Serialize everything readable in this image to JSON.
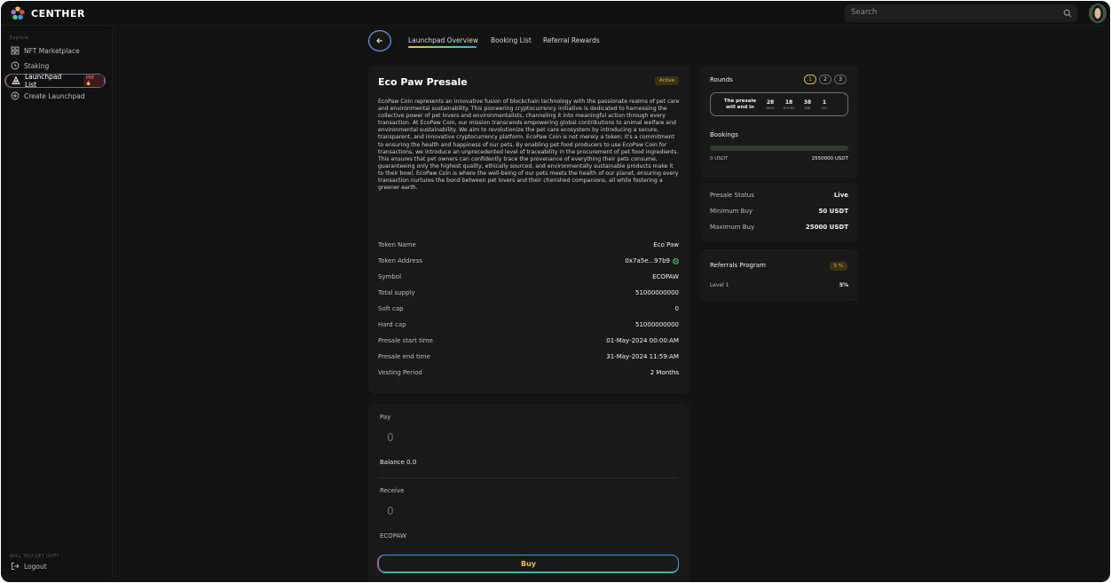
{
  "app": {
    "brand": "CENTHER"
  },
  "search": {
    "placeholder": "Search"
  },
  "sidebar": {
    "section_label": "Explore",
    "items": [
      {
        "label": "NFT Marketplace"
      },
      {
        "label": "Staking"
      },
      {
        "label": "Launchpad List",
        "badge": "PRE 🔥"
      },
      {
        "label": "Create Launchpad"
      }
    ],
    "footer_label": "WILL YOU GET OUT?",
    "logout": "Logout"
  },
  "tabs": [
    "Launchpad Overview",
    "Booking List",
    "Referral Rewards"
  ],
  "presale": {
    "title": "Eco Paw Presale",
    "status_badge": "Active",
    "description": "EcoPaw Coin represents an innovative fusion of blockchain technology with the passionate realms of pet care and environmental sustainability. This pioneering cryptocurrency initiative is dedicated to harnessing the collective power of pet lovers and environmentalists, channeling it into meaningful action through every transaction. At EcoPaw Coin, our mission transcends empowering global contributions to animal welfare and environmental sustainability. We aim to revolutionize the pet care ecosystem by introducing a secure, transparent, and innovative cryptocurrency platform. EcoPaw Coin is not merely a token; it's a commitment to ensuring the health and happiness of our pets. By enabling pet food producers to use EcoPaw Coin for transactions, we introduce an unprecedented level of traceability in the procurement of pet food ingredients. This ensures that pet owners can confidently trace the provenance of everything their pets consume, guaranteeing only the highest quality, ethically sourced, and environmentally sustainable products make it to their bowl. EcoPaw Coin is where the well-being of our pets meets the health of our planet, ensuring every transaction nurtures the bond between pet lovers and their cherished companions, all while fostering a greener earth.",
    "details": [
      {
        "label": "Token Name",
        "value": "Eco Paw"
      },
      {
        "label": "Token Address",
        "value": "0x7a5e...97b9"
      },
      {
        "label": "Symbol",
        "value": "ECOPAW"
      },
      {
        "label": "Total supply",
        "value": "51000000000"
      },
      {
        "label": "Soft cap",
        "value": "0"
      },
      {
        "label": "Hard cap",
        "value": "51000000000"
      },
      {
        "label": "Presale start time",
        "value": "01-May-2024 00:00:AM"
      },
      {
        "label": "Presale end time",
        "value": "31-May-2024 11:59:AM"
      },
      {
        "label": "Vesting Period",
        "value": "2 Months"
      }
    ]
  },
  "trade": {
    "pay_label": "Pay",
    "pay_value": "0",
    "balance": "Balance 0.0",
    "receive_label": "Receive",
    "receive_value": "0",
    "receive_token": "ECOPAW",
    "buy_label": "Buy"
  },
  "rounds": {
    "label": "Rounds",
    "pills": [
      "1",
      "2",
      "3"
    ],
    "active_round": "1",
    "countdown_label": "The presale will end in",
    "countdown": [
      {
        "value": "28",
        "unit": "DAYS"
      },
      {
        "value": "18",
        "unit": "HOURS"
      },
      {
        "value": "38",
        "unit": "MIN"
      },
      {
        "value": "1",
        "unit": "SEC"
      }
    ],
    "bookings_label": "Bookings",
    "bookings_min": "0 USDT",
    "bookings_max": "2550000 USDT",
    "bookings_progress": 0
  },
  "status": [
    {
      "label": "Presale Status",
      "value": "Live"
    },
    {
      "label": "Minimum Buy",
      "value": "50 USDT"
    },
    {
      "label": "Maximum Buy",
      "value": "25000 USDT"
    }
  ],
  "referrals": {
    "label": "Referrals Program",
    "badge": "5 %",
    "level_label": "Level 1",
    "level_value": "5%"
  },
  "colors": {
    "accent_gold": "#e0b54a",
    "accent_blue": "#4a8ff0",
    "background": "#131313",
    "card": "#191919"
  }
}
